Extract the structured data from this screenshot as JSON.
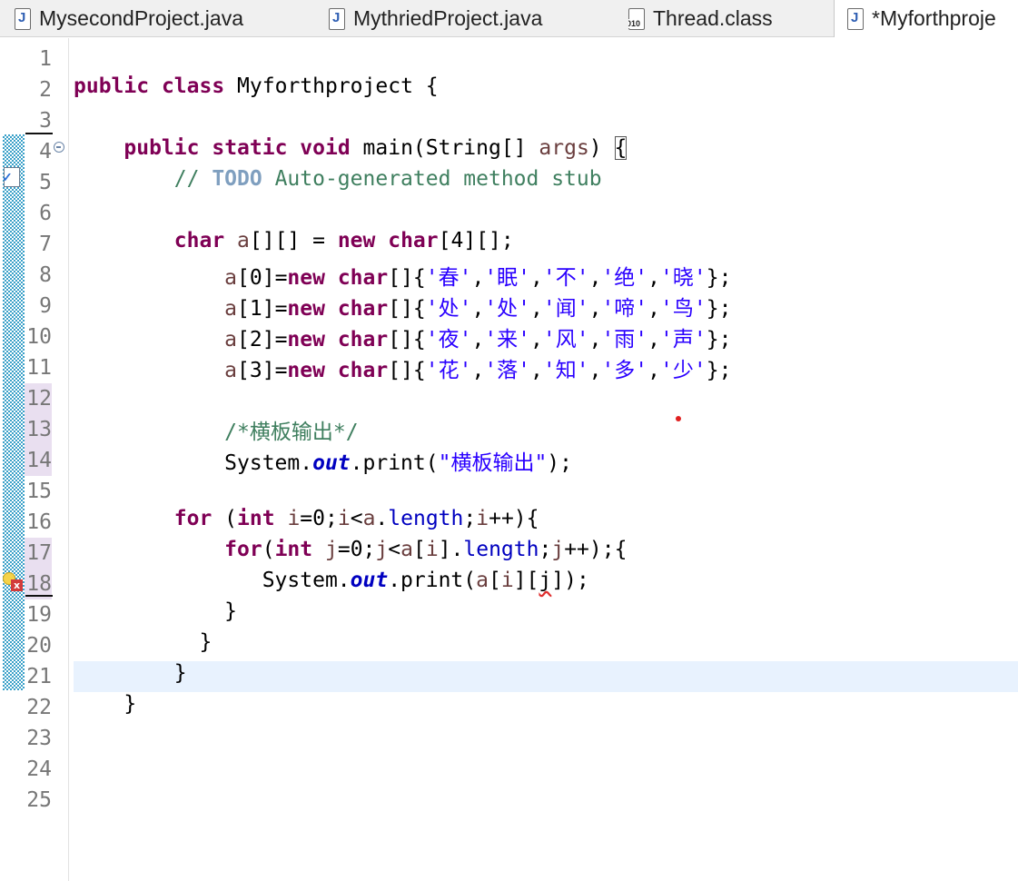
{
  "tabs": [
    {
      "label": "MysecondProject.java",
      "icon": "java-file-icon"
    },
    {
      "label": "MythriedProject.java",
      "icon": "java-file-icon"
    },
    {
      "label": "Thread.class",
      "icon": "class-file-icon"
    },
    {
      "label": "*Myforthproje",
      "icon": "java-file-icon"
    }
  ],
  "editor": {
    "line_numbers": [
      "1",
      "2",
      "3",
      "4",
      "5",
      "6",
      "7",
      "8",
      "9",
      "10",
      "11",
      "12",
      "13",
      "14",
      "15",
      "16",
      "17",
      "18",
      "19",
      "20",
      "21",
      "22",
      "23",
      "24",
      "25"
    ],
    "lines": [
      [],
      [
        [
          "k",
          "public"
        ],
        [
          "p",
          " "
        ],
        [
          "k",
          "class"
        ],
        [
          "p",
          " Myforthproject {"
        ]
      ],
      [],
      [
        [
          "p",
          "    "
        ],
        [
          "k",
          "public"
        ],
        [
          "p",
          " "
        ],
        [
          "k",
          "static"
        ],
        [
          "p",
          " "
        ],
        [
          "k",
          "void"
        ],
        [
          "p",
          " main(String[] "
        ],
        [
          "v",
          "args"
        ],
        [
          "p",
          ") "
        ],
        [
          "bm",
          "{"
        ]
      ],
      [
        [
          "p",
          "        "
        ],
        [
          "c",
          "// "
        ],
        [
          "todo",
          "TODO"
        ],
        [
          "c",
          " Auto-generated method stub"
        ]
      ],
      [],
      [
        [
          "p",
          "        "
        ],
        [
          "k",
          "char"
        ],
        [
          "p",
          " "
        ],
        [
          "v",
          "a"
        ],
        [
          "p",
          "[][] = "
        ],
        [
          "k",
          "new"
        ],
        [
          "p",
          " "
        ],
        [
          "k",
          "char"
        ],
        [
          "p",
          "[4][];"
        ]
      ],
      [
        [
          "p",
          "            "
        ],
        [
          "v",
          "a"
        ],
        [
          "p",
          "[0]="
        ],
        [
          "k",
          "new"
        ],
        [
          "p",
          " "
        ],
        [
          "k",
          "char"
        ],
        [
          "p",
          "[]{"
        ],
        [
          "s",
          "'春'"
        ],
        [
          "p",
          ","
        ],
        [
          "s",
          "'眠'"
        ],
        [
          "p",
          ","
        ],
        [
          "s",
          "'不'"
        ],
        [
          "p",
          ","
        ],
        [
          "s",
          "'绝'"
        ],
        [
          "p",
          ","
        ],
        [
          "s",
          "'晓'"
        ],
        [
          "p",
          "};"
        ]
      ],
      [
        [
          "p",
          "            "
        ],
        [
          "v",
          "a"
        ],
        [
          "p",
          "[1]="
        ],
        [
          "k",
          "new"
        ],
        [
          "p",
          " "
        ],
        [
          "k",
          "char"
        ],
        [
          "p",
          "[]{"
        ],
        [
          "s",
          "'处'"
        ],
        [
          "p",
          ","
        ],
        [
          "s",
          "'处'"
        ],
        [
          "p",
          ","
        ],
        [
          "s",
          "'闻'"
        ],
        [
          "p",
          ","
        ],
        [
          "s",
          "'啼'"
        ],
        [
          "p",
          ","
        ],
        [
          "s",
          "'鸟'"
        ],
        [
          "p",
          "};"
        ]
      ],
      [
        [
          "p",
          "            "
        ],
        [
          "v",
          "a"
        ],
        [
          "p",
          "[2]="
        ],
        [
          "k",
          "new"
        ],
        [
          "p",
          " "
        ],
        [
          "k",
          "char"
        ],
        [
          "p",
          "[]{"
        ],
        [
          "s",
          "'夜'"
        ],
        [
          "p",
          ","
        ],
        [
          "s",
          "'来'"
        ],
        [
          "p",
          ","
        ],
        [
          "s",
          "'风'"
        ],
        [
          "p",
          ","
        ],
        [
          "s",
          "'雨'"
        ],
        [
          "p",
          ","
        ],
        [
          "s",
          "'声'"
        ],
        [
          "p",
          "};"
        ]
      ],
      [
        [
          "p",
          "            "
        ],
        [
          "v",
          "a"
        ],
        [
          "p",
          "[3]="
        ],
        [
          "k",
          "new"
        ],
        [
          "p",
          " "
        ],
        [
          "k",
          "char"
        ],
        [
          "p",
          "[]{"
        ],
        [
          "s",
          "'花'"
        ],
        [
          "p",
          ","
        ],
        [
          "s",
          "'落'"
        ],
        [
          "p",
          ","
        ],
        [
          "s",
          "'知'"
        ],
        [
          "p",
          ","
        ],
        [
          "s",
          "'多'"
        ],
        [
          "p",
          ","
        ],
        [
          "s",
          "'少'"
        ],
        [
          "p",
          "};"
        ]
      ],
      [],
      [
        [
          "p",
          "            "
        ],
        [
          "c",
          "/*横板输出*/"
        ]
      ],
      [
        [
          "p",
          "            System."
        ],
        [
          "fi",
          "out"
        ],
        [
          "p",
          ".print("
        ],
        [
          "s",
          "\"横板输出\""
        ],
        [
          "p",
          ");"
        ]
      ],
      [],
      [
        [
          "p",
          "        "
        ],
        [
          "k",
          "for"
        ],
        [
          "p",
          " ("
        ],
        [
          "k",
          "int"
        ],
        [
          "p",
          " "
        ],
        [
          "v",
          "i"
        ],
        [
          "p",
          "=0;"
        ],
        [
          "v",
          "i"
        ],
        [
          "p",
          "<"
        ],
        [
          "v",
          "a"
        ],
        [
          "p",
          "."
        ],
        [
          "f",
          "length"
        ],
        [
          "p",
          ";"
        ],
        [
          "v",
          "i"
        ],
        [
          "p",
          "++){"
        ]
      ],
      [
        [
          "p",
          "            "
        ],
        [
          "k",
          "for"
        ],
        [
          "p",
          "("
        ],
        [
          "k",
          "int"
        ],
        [
          "p",
          " "
        ],
        [
          "v",
          "j"
        ],
        [
          "p",
          "=0;"
        ],
        [
          "v",
          "j"
        ],
        [
          "p",
          "<"
        ],
        [
          "v",
          "a"
        ],
        [
          "p",
          "["
        ],
        [
          "v",
          "i"
        ],
        [
          "p",
          "]."
        ],
        [
          "f",
          "length"
        ],
        [
          "p",
          ";"
        ],
        [
          "v",
          "j"
        ],
        [
          "p",
          "++);{"
        ]
      ],
      [
        [
          "p",
          "               System."
        ],
        [
          "fi",
          "out"
        ],
        [
          "p",
          ".print("
        ],
        [
          "v",
          "a"
        ],
        [
          "p",
          "["
        ],
        [
          "v",
          "i"
        ],
        [
          "p",
          "]["
        ],
        [
          "sq",
          "j"
        ],
        [
          "p",
          "]);"
        ]
      ],
      [
        [
          "p",
          "            }"
        ]
      ],
      [
        [
          "p",
          "          }"
        ]
      ],
      [
        [
          "p",
          "        }"
        ]
      ],
      [
        [
          "p",
          "    }"
        ]
      ],
      [],
      [],
      []
    ],
    "current_line": 21,
    "highlighted_lines": [
      12,
      13,
      14,
      17,
      18
    ]
  }
}
